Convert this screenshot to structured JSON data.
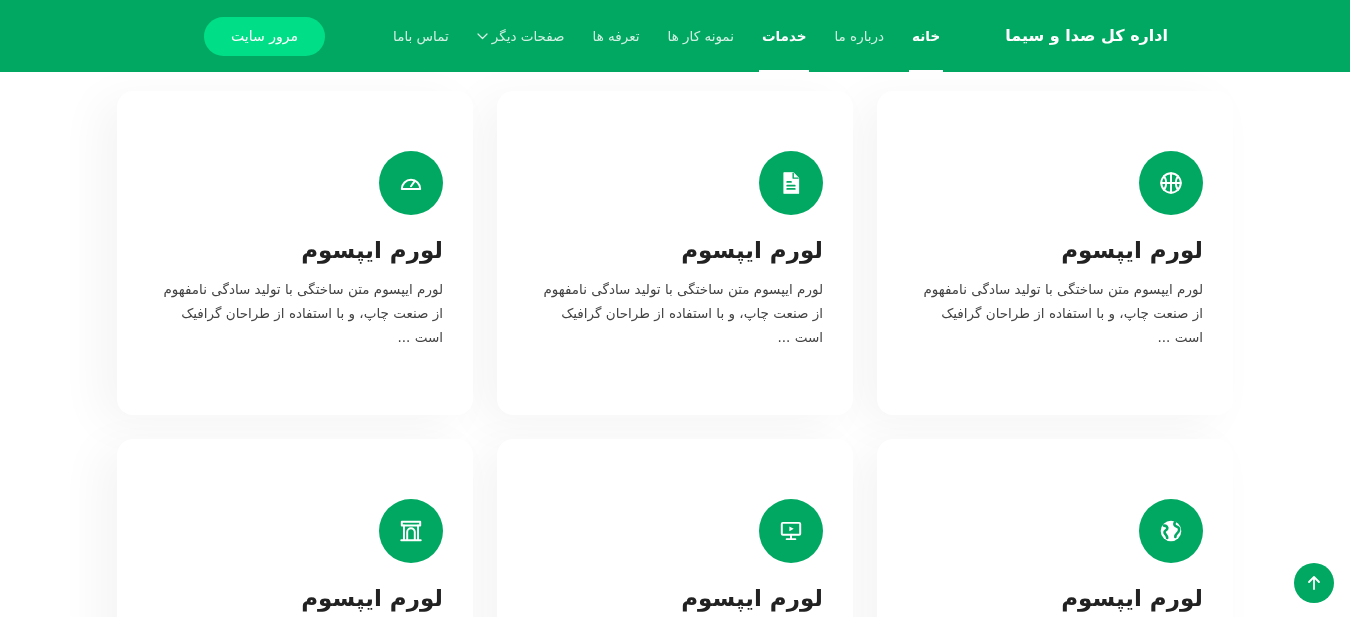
{
  "navbar": {
    "brand": "اداره کل صدا و سیما",
    "links": [
      {
        "label": "خانه",
        "kind": "link",
        "selected": true
      },
      {
        "label": "درباره ما",
        "kind": "link",
        "selected": false
      },
      {
        "label": "خدمات",
        "kind": "link",
        "selected": true
      },
      {
        "label": "نمونه کار ها",
        "kind": "link",
        "selected": false
      },
      {
        "label": "تعرفه ها",
        "kind": "link",
        "selected": false
      },
      {
        "label": "صفحات دیگر",
        "kind": "dropdown",
        "selected": false
      },
      {
        "label": "تماس باما",
        "kind": "link",
        "selected": false
      }
    ],
    "button": "مرور سایت"
  },
  "services": [
    {
      "title": "لورم ایپسوم",
      "text": "لورم ایپسوم متن ساختگی با تولید سادگی نامفهوم از صنعت چاپ، و با استفاده از طراحان گرافیک است ..."
    },
    {
      "title": "لورم ایپسوم",
      "text": "لورم ایپسوم متن ساختگی با تولید سادگی نامفهوم از صنعت چاپ، و با استفاده از طراحان گرافیک است ..."
    },
    {
      "title": "لورم ایپسوم",
      "text": "لورم ایپسوم متن ساختگی با تولید سادگی نامفهوم از صنعت چاپ، و با استفاده از طراحان گرافیک است ..."
    },
    {
      "title": "لورم ایپسوم"
    },
    {
      "title": "لورم ایپسوم"
    },
    {
      "title": "لورم ایپسوم"
    }
  ]
}
